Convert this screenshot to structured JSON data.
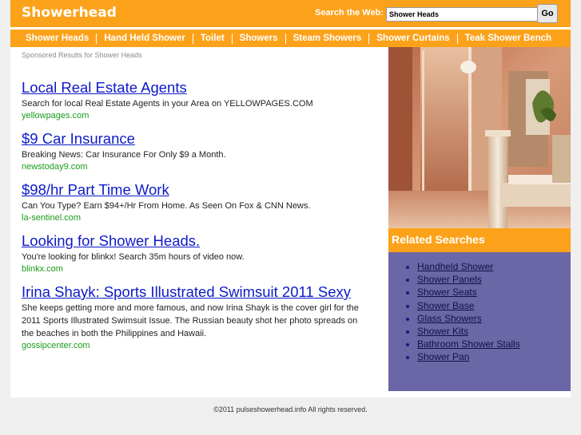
{
  "header": {
    "logo": "Showerhead",
    "search_label": "Search the Web:",
    "search_value": "Shower Heads",
    "go_label": "Go"
  },
  "nav": [
    "Shower Heads",
    "Hand Held Shower",
    "Toilet",
    "Showers",
    "Steam Showers",
    "Shower Curtains",
    "Teak Shower Bench"
  ],
  "sponsored_label": "Sponsored Results for Shower Heads",
  "results": [
    {
      "title": "Local Real Estate Agents",
      "desc": "Search for local Real Estate Agents in your Area on YELLOWPAGES.COM",
      "url": "yellowpages.com"
    },
    {
      "title": "$9 Car Insurance",
      "desc": "Breaking News: Car Insurance For Only $9 a Month.",
      "url": "newstoday9.com"
    },
    {
      "title": "$98/hr Part Time Work",
      "desc": "Can You Type? Earn $94+/Hr From Home. As Seen On Fox & CNN News.",
      "url": "la-sentinel.com"
    },
    {
      "title": "Looking for Shower Heads.",
      "desc": "You're looking for blinkx! Search 35m hours of video now.",
      "url": "blinkx.com"
    },
    {
      "title": "Irina Shayk: Sports Illustrated Swimsuit 2011 Sexy",
      "desc": "She keeps getting more and more famous, and now Irina Shayk is the cover girl for the 2011 Sports Illustrated Swimsuit Issue. The Russian beauty shot her photo spreads on the beaches in both the Philippines and Hawaii.",
      "url": "gossipcenter.com"
    }
  ],
  "related": {
    "title": "Related Searches",
    "items": [
      "Handheld Shower",
      "Shower Panels",
      "Shower Seats",
      "Shower Base",
      "Glass Showers",
      "Shower Kits",
      "Bathroom Shower Stalls",
      "Shower Pan"
    ]
  },
  "footer": "©2011 pulseshowerhead.info All rights reserved."
}
